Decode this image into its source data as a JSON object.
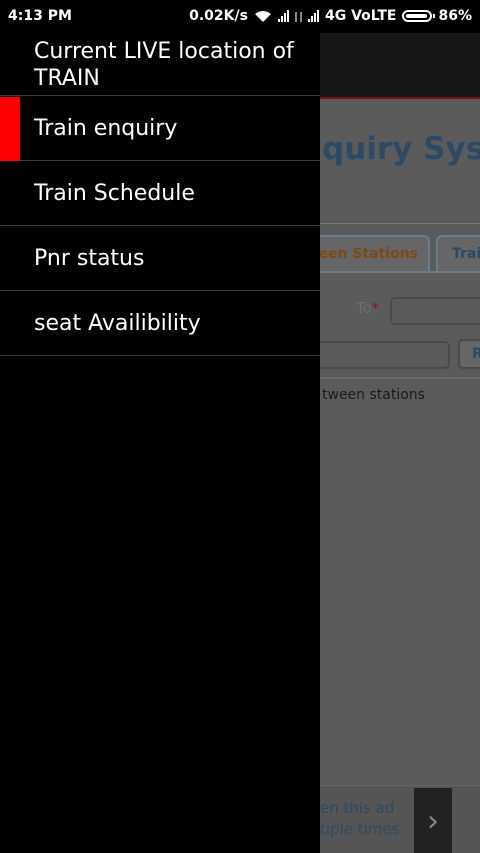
{
  "status_bar": {
    "time": "4:13 PM",
    "speed": "0.02K/s",
    "network": "4G VoLTE",
    "battery": "86%"
  },
  "drawer": {
    "header": "Current LIVE location of TRAIN",
    "items": [
      {
        "label": "Train enquiry",
        "selected": true
      },
      {
        "label": "Train Schedule",
        "selected": false
      },
      {
        "label": "Pnr status",
        "selected": false
      },
      {
        "label": "seat Availibility",
        "selected": false
      }
    ],
    "accent_color": "#ff0000"
  },
  "background_page": {
    "heading": "quiry Syster",
    "tabs": [
      "tween Stations",
      "Trai"
    ],
    "to_label": "To",
    "required_mark": "*",
    "button_label": "R",
    "between_text": "tween stations",
    "ad_text_line1": "en this ad",
    "ad_text_line2": "tiple times",
    "ad_arrow": "›"
  }
}
